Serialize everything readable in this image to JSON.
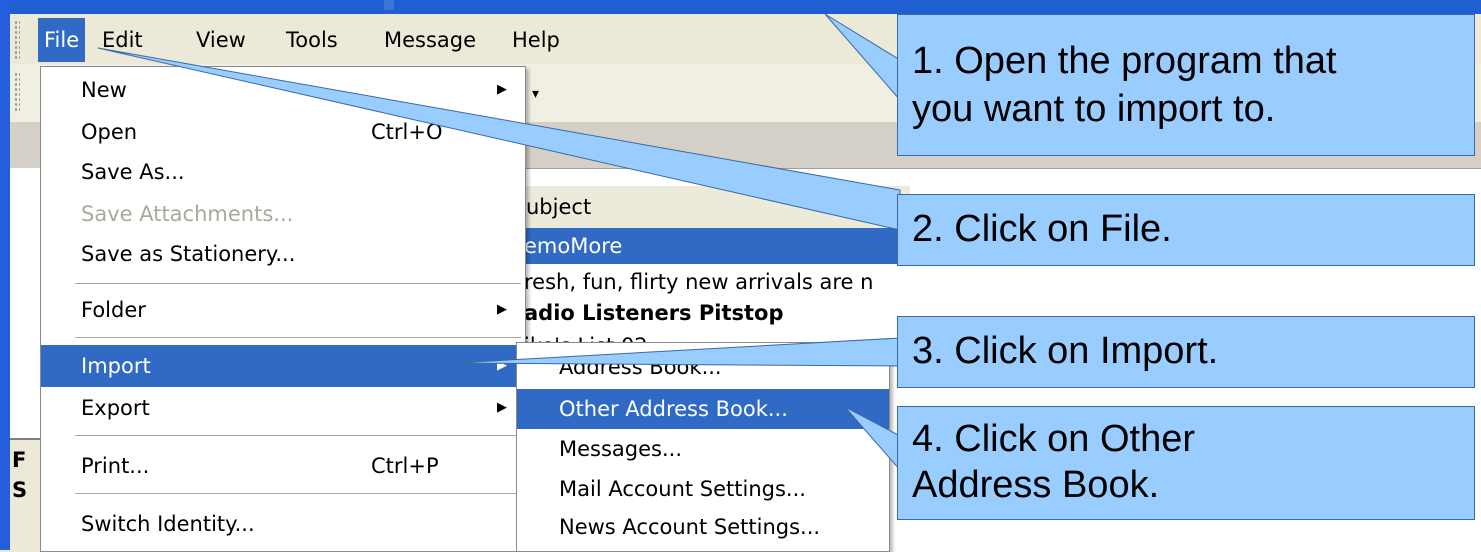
{
  "menubar": {
    "items": [
      "File",
      "Edit",
      "View",
      "Tools",
      "Message",
      "Help"
    ]
  },
  "file_menu": {
    "items": [
      {
        "label": "New",
        "submenu": true
      },
      {
        "label": "Open",
        "shortcut": "Ctrl+O"
      },
      {
        "label": "Save As..."
      },
      {
        "label": "Save Attachments...",
        "disabled": true
      },
      {
        "label": "Save as Stationery..."
      },
      {
        "label": "Folder",
        "submenu": true
      },
      {
        "label": "Import",
        "submenu": true,
        "highlighted": true
      },
      {
        "label": "Export",
        "submenu": true
      },
      {
        "label": "Print...",
        "shortcut": "Ctrl+P"
      },
      {
        "label": "Switch Identity..."
      }
    ]
  },
  "import_submenu": {
    "items": [
      {
        "label": "Address Book..."
      },
      {
        "label": "Other Address Book...",
        "highlighted": true
      },
      {
        "label": "Messages..."
      },
      {
        "label": "Mail Account Settings..."
      },
      {
        "label": "News Account Settings..."
      }
    ]
  },
  "message_list": {
    "column_header": "ubject",
    "rows": [
      {
        "text": "emoMore",
        "selected": true
      },
      {
        "text": "resh, fun, flirty new arrivals are n"
      },
      {
        "text": "adio Listeners Pitstop",
        "bold": true
      },
      {
        "text": "ike's List 02"
      }
    ]
  },
  "left_pane": {
    "labels": [
      "F",
      "S"
    ]
  },
  "callouts": [
    {
      "lines": [
        "1. Open the program that",
        "you want to import to."
      ]
    },
    {
      "lines": [
        "2. Click on File."
      ]
    },
    {
      "lines": [
        "3. Click on Import."
      ]
    },
    {
      "lines": [
        "4. Click on Other",
        "Address Book."
      ]
    }
  ],
  "colors": {
    "highlight": "#316ac5",
    "callout_fill": "#99ccff",
    "menubar_bg": "#ece9d8"
  }
}
